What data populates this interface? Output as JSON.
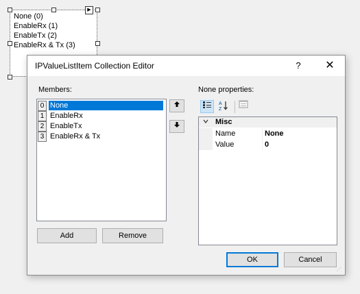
{
  "designer_list": {
    "items": [
      "None (0)",
      "EnableRx (1)",
      "EnableTx (2)",
      "EnableRx & Tx (3)"
    ]
  },
  "dialog": {
    "title": "IPValueListItem Collection Editor",
    "help_label": "?",
    "close_label": "✕",
    "members_label": "Members:",
    "members": [
      {
        "index": "0",
        "name": "None",
        "selected": true
      },
      {
        "index": "1",
        "name": "EnableRx",
        "selected": false
      },
      {
        "index": "2",
        "name": "EnableTx",
        "selected": false
      },
      {
        "index": "3",
        "name": "EnableRx & Tx",
        "selected": false
      }
    ],
    "move_up_icon": "arrow-up",
    "move_down_icon": "arrow-down",
    "add_label": "Add",
    "remove_label": "Remove",
    "properties_label": "None properties:",
    "toolbar": {
      "categorized_icon": "categorized",
      "alphabetical_icon": "alphabetical",
      "property_pages_icon": "property-pages"
    },
    "property_grid": {
      "category": "Misc",
      "rows": [
        {
          "name": "Name",
          "value": "None"
        },
        {
          "name": "Value",
          "value": "0"
        }
      ]
    },
    "ok_label": "OK",
    "cancel_label": "Cancel",
    "accent_color": "#0078d7"
  }
}
